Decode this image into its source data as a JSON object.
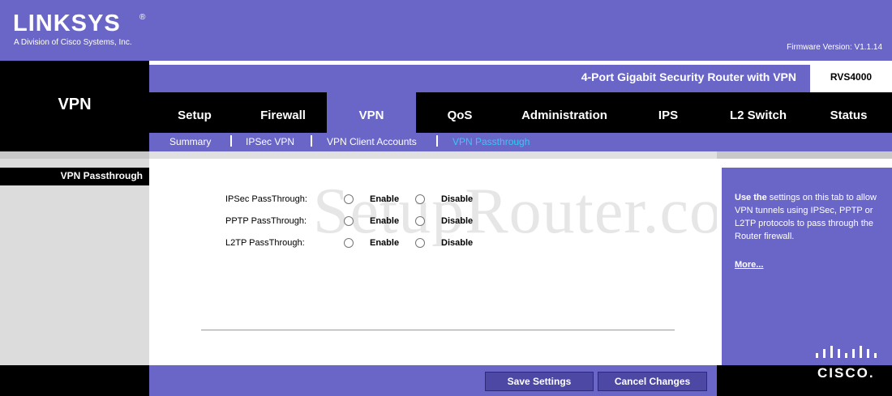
{
  "header": {
    "logo_text": "LINKSYS",
    "logo_mark": "®",
    "logo_sub": "A Division of Cisco Systems, Inc.",
    "firmware": "Firmware Version: V1.1.14",
    "product_name": "4-Port Gigabit Security Router with VPN",
    "model": "RVS4000"
  },
  "section_title": "VPN",
  "tabs": [
    {
      "label": "Setup"
    },
    {
      "label": "Firewall"
    },
    {
      "label": "VPN",
      "active": true
    },
    {
      "label": "QoS"
    },
    {
      "label": "Administration"
    },
    {
      "label": "IPS"
    },
    {
      "label": "L2 Switch"
    },
    {
      "label": "Status"
    }
  ],
  "subtabs": [
    {
      "label": "Summary"
    },
    {
      "label": "IPSec VPN"
    },
    {
      "label": "VPN Client Accounts"
    },
    {
      "label": "VPN Passthrough",
      "active": true
    }
  ],
  "sidebar": {
    "label": "VPN Passthrough"
  },
  "form": {
    "rows": [
      {
        "label": "IPSec PassThrough:",
        "enable": "Enable",
        "disable": "Disable"
      },
      {
        "label": "PPTP PassThrough:",
        "enable": "Enable",
        "disable": "Disable"
      },
      {
        "label": "L2TP PassThrough:",
        "enable": "Enable",
        "disable": "Disable"
      }
    ]
  },
  "watermark": "SetupRouter.com",
  "help": {
    "lead": "Use the",
    "text": " settings on this tab to allow VPN tunnels using IPSec, PPTP or L2TP protocols to pass through the Router firewall.",
    "more": "More..."
  },
  "footer": {
    "save": "Save Settings",
    "cancel": "Cancel Changes"
  },
  "brand": {
    "cisco": "CISCO."
  },
  "colors": {
    "accent": "#6a66c8",
    "active_subtab": "#34c9f2"
  }
}
